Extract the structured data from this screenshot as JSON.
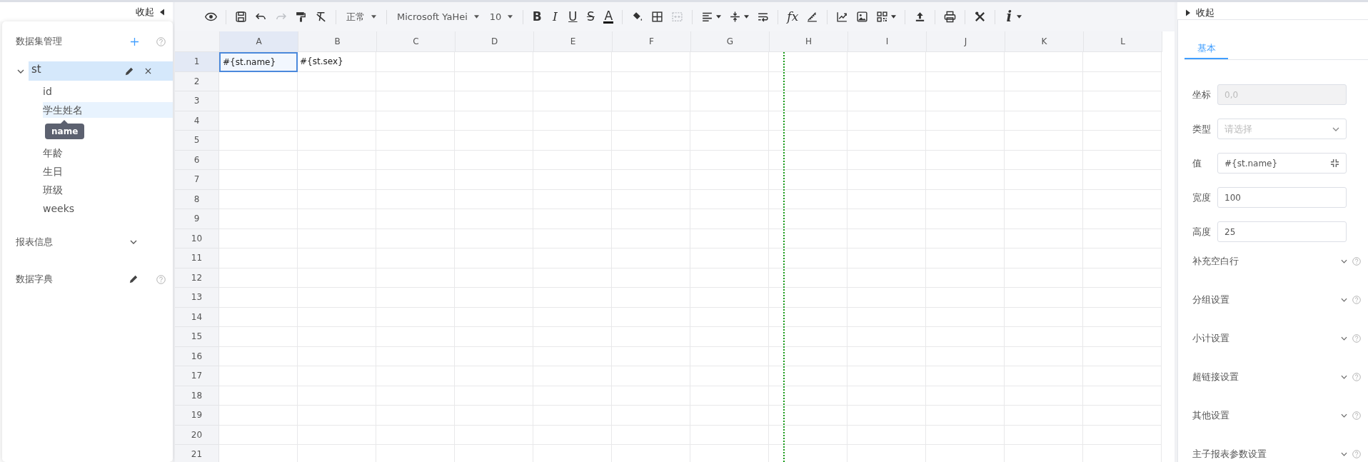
{
  "left_panel": {
    "collapse_label": "收起",
    "dataset_section": {
      "title": "数据集管理"
    },
    "datasets": [
      {
        "name": "st",
        "expanded": true,
        "selected": true,
        "fields": [
          {
            "label": "id",
            "hovered": false
          },
          {
            "label": "学生姓名",
            "hovered": true,
            "tooltip": "name"
          },
          {
            "label": "年龄",
            "hovered": false
          },
          {
            "label": "生日",
            "hovered": false
          },
          {
            "label": "班级",
            "hovered": false
          },
          {
            "label": "weeks",
            "hovered": false
          }
        ]
      }
    ],
    "report_info": {
      "title": "报表信息"
    },
    "dictionary": {
      "title": "数据字典"
    }
  },
  "toolbar": {
    "groups": [
      [
        {
          "kind": "icon",
          "disabled": false,
          "dropdown": false
        }
      ],
      [
        {
          "kind": "icon",
          "disabled": false,
          "dropdown": false
        },
        {
          "kind": "icon",
          "disabled": false,
          "dropdown": false
        },
        {
          "kind": "icon",
          "disabled": true,
          "dropdown": false
        },
        {
          "kind": "icon",
          "disabled": false,
          "dropdown": false
        },
        {
          "kind": "icon",
          "disabled": false,
          "dropdown": false
        }
      ],
      [
        {
          "kind": "select",
          "text": "正常"
        }
      ],
      [
        {
          "kind": "select",
          "text": "Microsoft YaHei"
        },
        {
          "kind": "select",
          "text": "10"
        }
      ],
      [
        {
          "kind": "glyph",
          "text": "B",
          "disabled": false,
          "dropdown": false
        },
        {
          "kind": "glyph",
          "text": "I",
          "disabled": false,
          "dropdown": false
        },
        {
          "kind": "glyph",
          "text": "U",
          "disabled": false,
          "dropdown": false
        },
        {
          "kind": "glyph",
          "text": "S",
          "disabled": false,
          "dropdown": false
        },
        {
          "kind": "glyph",
          "text": "A",
          "disabled": false,
          "dropdown": false
        }
      ],
      [
        {
          "kind": "icon",
          "disabled": false,
          "dropdown": false
        },
        {
          "kind": "icon",
          "disabled": false,
          "dropdown": false
        },
        {
          "kind": "icon",
          "disabled": true,
          "dropdown": false
        }
      ],
      [
        {
          "kind": "icon",
          "disabled": false,
          "dropdown": true
        },
        {
          "kind": "icon",
          "disabled": false,
          "dropdown": true
        },
        {
          "kind": "icon",
          "disabled": false,
          "dropdown": false
        }
      ],
      [
        {
          "kind": "glyph",
          "text": "fx",
          "disabled": false,
          "dropdown": false
        },
        {
          "kind": "icon",
          "disabled": false,
          "dropdown": false
        }
      ],
      [
        {
          "kind": "icon",
          "disabled": false,
          "dropdown": false
        },
        {
          "kind": "icon",
          "disabled": false,
          "dropdown": false
        },
        {
          "kind": "icon",
          "disabled": false,
          "dropdown": true
        }
      ],
      [
        {
          "kind": "icon",
          "disabled": false,
          "dropdown": false
        }
      ],
      [
        {
          "kind": "icon",
          "disabled": false,
          "dropdown": false
        }
      ],
      [
        {
          "kind": "icon",
          "disabled": false,
          "dropdown": false
        }
      ],
      [
        {
          "kind": "glyph",
          "text": "i",
          "disabled": false,
          "dropdown": true
        }
      ]
    ]
  },
  "grid": {
    "columns": [
      {
        "label": "A",
        "selected": true
      },
      {
        "label": "B",
        "selected": false
      },
      {
        "label": "C",
        "selected": false
      },
      {
        "label": "D",
        "selected": false
      },
      {
        "label": "E",
        "selected": false
      },
      {
        "label": "F",
        "selected": false
      },
      {
        "label": "G",
        "selected": false
      },
      {
        "label": "H",
        "selected": false
      },
      {
        "label": "I",
        "selected": false
      },
      {
        "label": "J",
        "selected": false
      },
      {
        "label": "K",
        "selected": false
      },
      {
        "label": "L",
        "selected": false
      }
    ],
    "rows": [
      {
        "label": "1",
        "selected": true,
        "cells": [
          {
            "text": "#{st.name}",
            "selected": true
          },
          {
            "text": "#{st.sex}",
            "selected": false
          }
        ]
      },
      {
        "label": "2",
        "selected": false
      },
      {
        "label": "3",
        "selected": false
      },
      {
        "label": "4",
        "selected": false
      },
      {
        "label": "5",
        "selected": false
      },
      {
        "label": "6",
        "selected": false
      },
      {
        "label": "7",
        "selected": false
      },
      {
        "label": "8",
        "selected": false
      },
      {
        "label": "9",
        "selected": false
      },
      {
        "label": "10",
        "selected": false
      },
      {
        "label": "11",
        "selected": false
      },
      {
        "label": "12",
        "selected": false
      },
      {
        "label": "13",
        "selected": false
      },
      {
        "label": "14",
        "selected": false
      },
      {
        "label": "15",
        "selected": false
      },
      {
        "label": "16",
        "selected": false
      },
      {
        "label": "17",
        "selected": false
      },
      {
        "label": "18",
        "selected": false
      },
      {
        "label": "19",
        "selected": false
      },
      {
        "label": "20",
        "selected": false
      },
      {
        "label": "21",
        "selected": false
      }
    ]
  },
  "right_panel": {
    "collapse_label": "收起",
    "tabs": [
      {
        "label": "基本",
        "selected": true
      }
    ],
    "fields": [
      {
        "label": "坐标",
        "kind": "text",
        "value": "0,0",
        "disabled": true
      },
      {
        "label": "类型",
        "kind": "select",
        "placeholder": "请选择",
        "disabled": false
      },
      {
        "label": "值",
        "kind": "expand",
        "value": "#{st.name}",
        "disabled": false
      },
      {
        "label": "宽度",
        "kind": "text",
        "value": "100",
        "disabled": false
      },
      {
        "label": "高度",
        "kind": "text",
        "value": "25",
        "disabled": false
      }
    ],
    "sections": [
      {
        "title": "补充空白行",
        "expanded": false
      },
      {
        "title": "分组设置",
        "expanded": false
      },
      {
        "title": "小计设置",
        "expanded": false
      },
      {
        "title": "超链接设置",
        "expanded": false
      },
      {
        "title": "其他设置",
        "expanded": false
      },
      {
        "title": "主子报表参数设置",
        "expanded": false
      }
    ]
  }
}
